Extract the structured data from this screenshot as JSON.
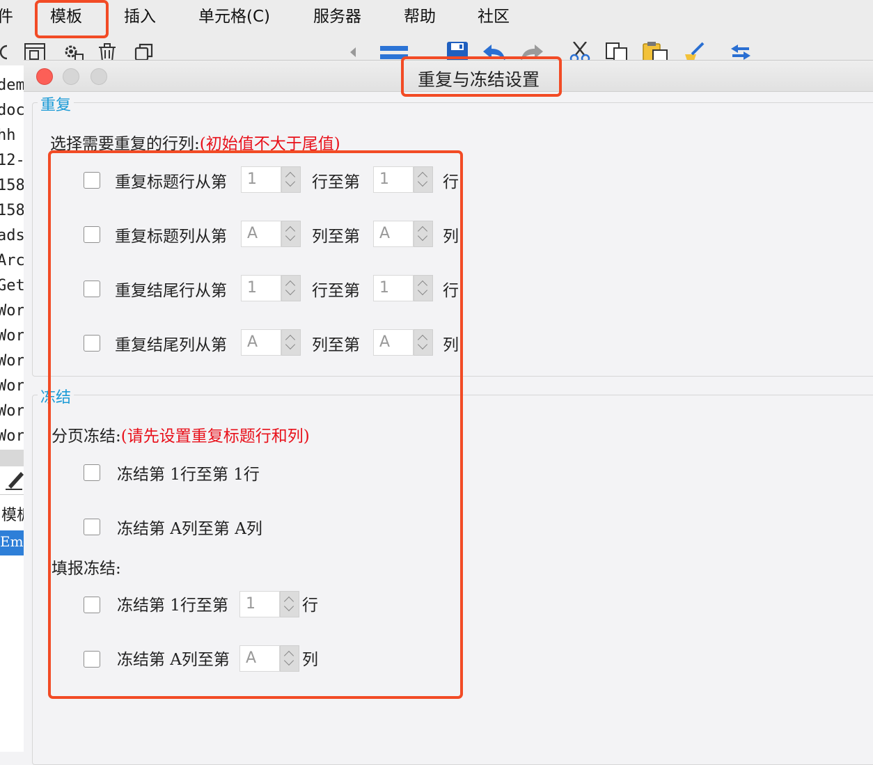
{
  "menu": {
    "items": [
      {
        "label": "件"
      },
      {
        "label": "模板"
      },
      {
        "label": "插入"
      },
      {
        "label": "单元格(C)"
      },
      {
        "label": "服务器"
      },
      {
        "label": "帮助"
      },
      {
        "label": "社区"
      }
    ]
  },
  "toolbar": {
    "icons": [
      "refresh-icon",
      "report-icon",
      "settings-icon",
      "delete-icon",
      "copy-window-icon",
      "scroll-left-icon",
      "align-icon",
      "save-icon",
      "undo-icon",
      "redo-icon",
      "cut-icon",
      "copy-icon",
      "paste-icon",
      "format-brush-icon",
      "swap-icon"
    ]
  },
  "sidebar": {
    "items": [
      "dem",
      "doc",
      "hh",
      "12-",
      "158",
      "158",
      "ads",
      "Arc",
      "Get",
      "Wor",
      "Wor",
      "Wor",
      "Wor",
      "Wor",
      "Wor"
    ],
    "bottom_label": "模板",
    "selected_item": "Emb"
  },
  "dialog": {
    "title": "重复与冻结设置",
    "repeat": {
      "legend": "重复",
      "prompt": "选择需要重复的行列:",
      "prompt_note": "(初始值不大于尾值)",
      "rows": [
        {
          "label": "重复标题行从第",
          "from": "1",
          "middle": "行至第",
          "to": "1",
          "unit": "行"
        },
        {
          "label": "重复标题列从第",
          "from": "A",
          "middle": "列至第",
          "to": "A",
          "unit": "列"
        },
        {
          "label": "重复结尾行从第",
          "from": "1",
          "middle": "行至第",
          "to": "1",
          "unit": "行"
        },
        {
          "label": "重复结尾列从第",
          "from": "A",
          "middle": "列至第",
          "to": "A",
          "unit": "列"
        }
      ]
    },
    "freeze": {
      "legend": "冻结",
      "page_prompt": "分页冻结:",
      "page_note": "(请先设置重复标题行和列)",
      "page_row": "冻结第 1行至第 1行",
      "page_col": "冻结第 A列至第 A列",
      "fill_prompt": "填报冻结:",
      "fill_row": {
        "label": "冻结第 1行至第",
        "value": "1",
        "unit": "行"
      },
      "fill_col": {
        "label": "冻结第 A列至第",
        "value": "A",
        "unit": "列"
      }
    }
  },
  "colors": {
    "accent": "#1c9bd6",
    "note": "#e8101a",
    "highlight": "#f24b25",
    "close": "#fc5f57"
  }
}
